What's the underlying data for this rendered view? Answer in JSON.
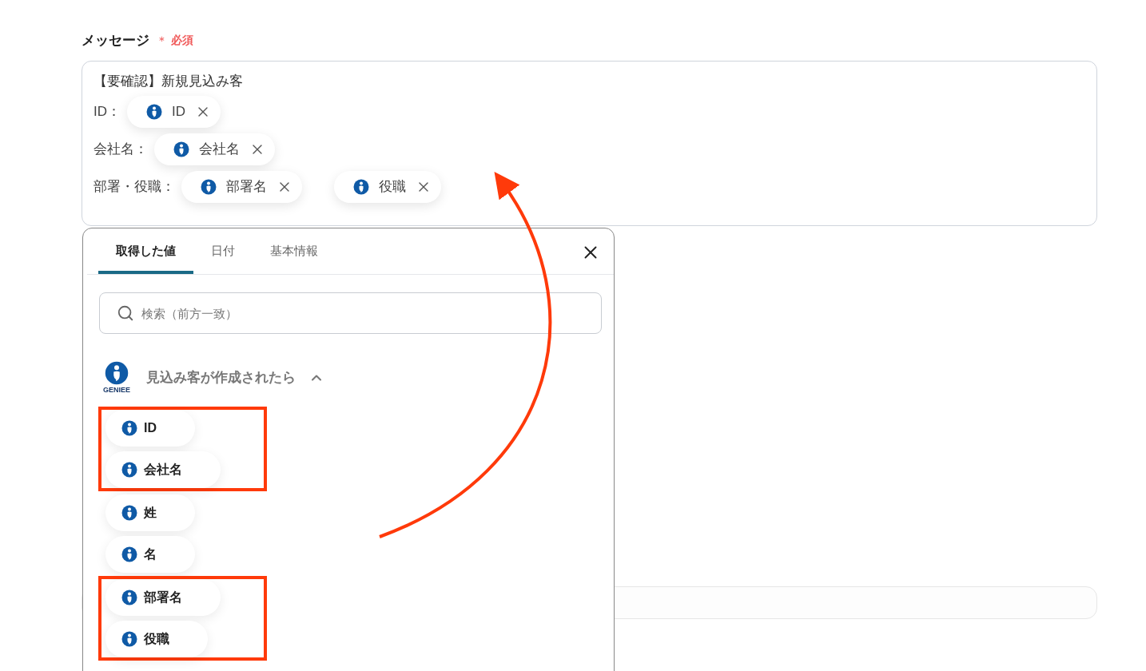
{
  "field": {
    "label": "メッセージ",
    "required_mark": "＊",
    "required_text": "必須"
  },
  "message": {
    "first_line": "【要確認】新規見込み客",
    "rows": [
      {
        "label": "ID：",
        "chips": [
          {
            "text": "ID"
          }
        ]
      },
      {
        "label": "会社名：",
        "chips": [
          {
            "text": "会社名"
          }
        ]
      },
      {
        "label": "部署・役職：",
        "chips": [
          {
            "text": "部署名"
          },
          {
            "text": "役職"
          }
        ]
      }
    ]
  },
  "popup": {
    "tabs": [
      {
        "label": "取得した値",
        "selected": true
      },
      {
        "label": "日付",
        "selected": false
      },
      {
        "label": "基本情報",
        "selected": false
      }
    ],
    "search": {
      "placeholder": "検索（前方一致）"
    },
    "group": {
      "logo_text": "GENIEE",
      "title": "見込み客が作成されたら",
      "expanded": true,
      "items": [
        {
          "text": "ID",
          "highlighted": true
        },
        {
          "text": "会社名",
          "highlighted": true
        },
        {
          "text": "姓",
          "highlighted": false
        },
        {
          "text": "名",
          "highlighted": false
        },
        {
          "text": "部署名",
          "highlighted": true
        },
        {
          "text": "役職",
          "highlighted": true
        }
      ]
    }
  }
}
